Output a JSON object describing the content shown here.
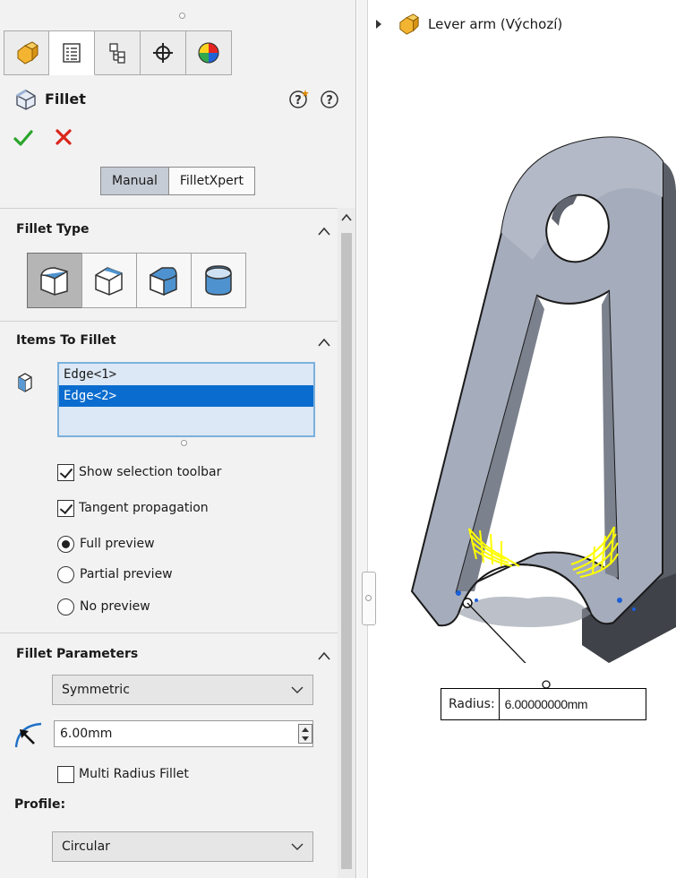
{
  "graphics": {
    "tree_root_label": "Lever arm  (Výchozí)",
    "callout": {
      "label": "Radius:",
      "value": "6.00000000mm"
    }
  },
  "panel": {
    "tabs": [
      {
        "name": "featuremanager-tab",
        "icon": "parts-icon"
      },
      {
        "name": "propertymanager-tab",
        "icon": "property-list-icon",
        "active": true
      },
      {
        "name": "configurationmanager-tab",
        "icon": "configuration-icon"
      },
      {
        "name": "dimxpertmanager-tab",
        "icon": "crosshair-icon"
      },
      {
        "name": "displaymanager-tab",
        "icon": "appearance-icon"
      }
    ],
    "title": "Fillet",
    "modes": {
      "manual": "Manual",
      "filletxpert": "FilletXpert"
    },
    "groups": {
      "fillet_type": {
        "title": "Fillet Type"
      },
      "items_to_fillet": {
        "title": "Items To Fillet",
        "edges": [
          "Edge<1>",
          "Edge<2>"
        ],
        "selected_index": 1
      },
      "options": {
        "show_selection_toolbar": "Show selection toolbar",
        "tangent_propagation": "Tangent propagation",
        "full_preview": "Full preview",
        "partial_preview": "Partial preview",
        "no_preview": "No preview"
      },
      "fillet_parameters": {
        "title": "Fillet Parameters",
        "method": "Symmetric",
        "radius": "6.00mm",
        "multi_radius": "Multi Radius Fillet",
        "profile_label": "Profile:",
        "profile": "Circular"
      }
    }
  },
  "colors": {
    "ok_green": "#2aa52a",
    "cancel_red": "#d9261c",
    "selection_blue": "#0a6ccf",
    "fillet_preview_yellow": "#ffff00",
    "model_face": "#9fa7b7"
  }
}
